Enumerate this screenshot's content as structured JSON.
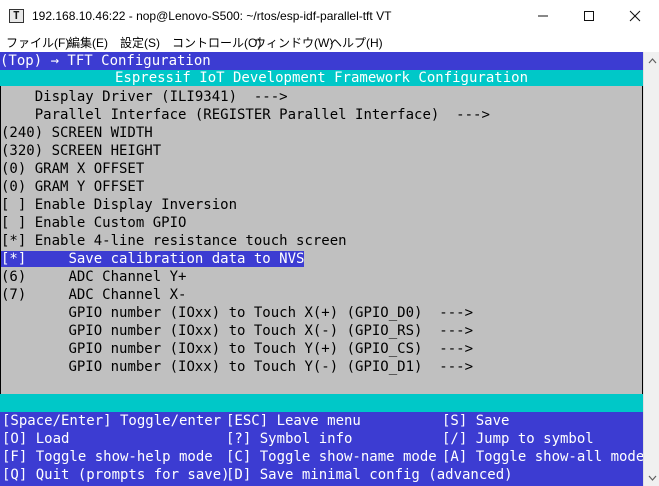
{
  "window": {
    "title": "192.168.10.46:22 - nop@Lenovo-S500: ~/rtos/esp-idf-parallel-tft VT"
  },
  "menubar": {
    "items": [
      "ファイル(F)",
      "編集(E)",
      "設定(S)",
      "コントロール(O)",
      "ウィンドウ(W)",
      "ヘルプ(H)"
    ]
  },
  "terminal": {
    "breadcrumb": "(Top) → TFT Configuration",
    "header": "Espressif IoT Development Framework Configuration",
    "items": [
      {
        "prefix": "    ",
        "text": "Display Driver (ILI9341)  --->"
      },
      {
        "prefix": "    ",
        "text": "Parallel Interface (REGISTER Parallel Interface)  --->"
      },
      {
        "prefix": "(240) ",
        "text": "SCREEN WIDTH"
      },
      {
        "prefix": "(320) ",
        "text": "SCREEN HEIGHT"
      },
      {
        "prefix": "(0) ",
        "text": "GRAM X OFFSET"
      },
      {
        "prefix": "(0) ",
        "text": "GRAM Y OFFSET"
      },
      {
        "prefix": "[ ] ",
        "text": "Enable Display Inversion"
      },
      {
        "prefix": "[ ] ",
        "text": "Enable Custom GPIO"
      },
      {
        "prefix": "[*] ",
        "text": "Enable 4-line resistance touch screen"
      },
      {
        "prefix": "[*]     ",
        "text": "Save calibration data to NVS"
      },
      {
        "prefix": "(6)     ",
        "text": "ADC Channel Y+"
      },
      {
        "prefix": "(7)     ",
        "text": "ADC Channel X-"
      },
      {
        "prefix": "        ",
        "text": "GPIO number (IOxx) to Touch X(+) (GPIO_D0)  --->"
      },
      {
        "prefix": "        ",
        "text": "GPIO number (IOxx) to Touch X(-) (GPIO_RS)  --->"
      },
      {
        "prefix": "        ",
        "text": "GPIO number (IOxx) to Touch Y(+) (GPIO_CS)  --->"
      },
      {
        "prefix": "        ",
        "text": "GPIO number (IOxx) to Touch Y(-) (GPIO_D1)  --->"
      }
    ],
    "help": [
      [
        "[Space/Enter] Toggle/enter",
        "[ESC] Leave menu",
        "[S] Save"
      ],
      [
        "[O] Load",
        "[?] Symbol info",
        "[/] Jump to symbol"
      ],
      [
        "[F] Toggle show-help mode",
        "[C] Toggle show-name mode",
        "[A] Toggle show-all mode"
      ],
      [
        "[Q] Quit (prompts for save)",
        "[D] Save minimal config (advanced)",
        ""
      ]
    ]
  },
  "colors": {
    "terminal_bg": "#c0c0c0",
    "blue": "#3c3cd2",
    "cyan": "#00c8c8",
    "text_light": "#ffffff",
    "text_dark": "#000000"
  },
  "icons": {
    "app": "terminal-app-icon",
    "minimize": "minimize-icon",
    "maximize": "maximize-icon",
    "close": "close-icon",
    "scroll_up": "arrow-up-icon",
    "scroll_down": "arrow-down-icon"
  }
}
